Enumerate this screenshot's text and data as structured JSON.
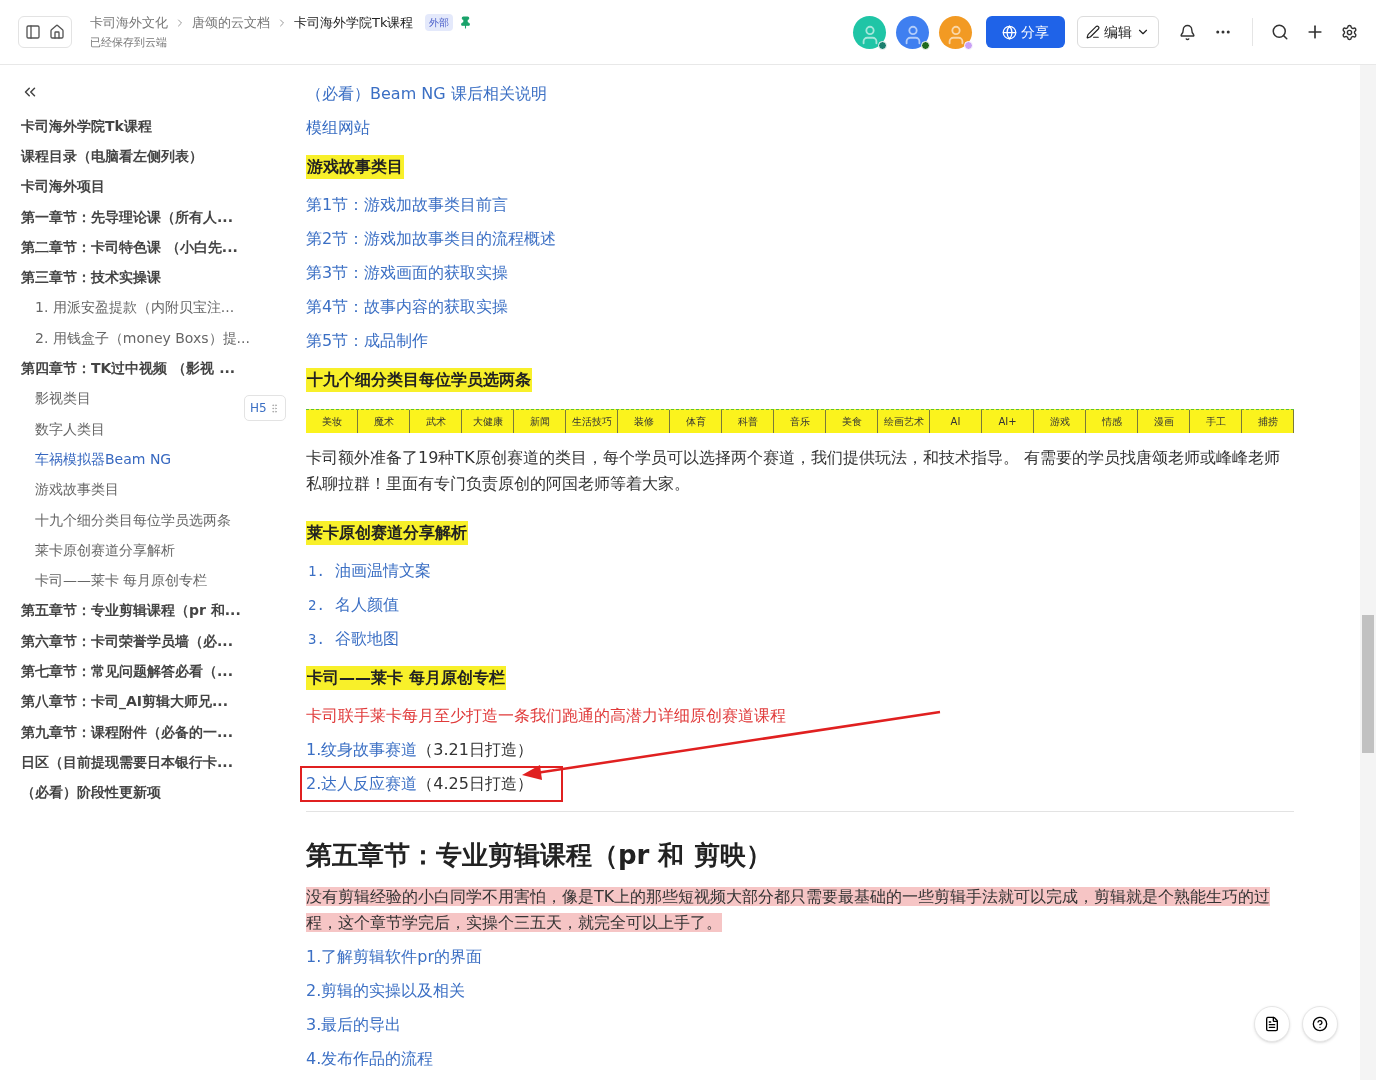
{
  "header": {
    "breadcrumbs": [
      {
        "label": "卡司海外文化",
        "current": false
      },
      {
        "label": "唐颂的云文档",
        "current": false
      },
      {
        "label": "卡司海外学院Tk课程",
        "current": true
      }
    ],
    "badge": "外部",
    "save_status": "已经保存到云端",
    "avatars": [
      {
        "color": "#1fc5a6",
        "status_dot": {
          "color": "#1a7f6e"
        }
      },
      {
        "color": "#3f7ff0",
        "status_dot": {
          "color": "#1f6b1f"
        }
      },
      {
        "color": "#f29a23",
        "status_dot": {
          "color": "#c9a0f5"
        }
      }
    ],
    "share_button": "分享",
    "edit_button": "编辑"
  },
  "sidebar": {
    "items": [
      {
        "label": "卡司海外学院Tk课程",
        "selected": false
      },
      {
        "label": "课程目录（电脑看左侧列表）",
        "selected": false
      },
      {
        "label": "卡司海外项目",
        "selected": false
      },
      {
        "label": "第一章节：先导理论课（所有人...",
        "selected": false
      },
      {
        "label": "第二章节：卡司特色课 （小白先...",
        "selected": false
      },
      {
        "label": "第三章节：技术实操课",
        "selected": false,
        "children": [
          {
            "label": "1. 用派安盈提款（内附贝宝注...",
            "selected": false
          },
          {
            "label": "2. 用钱盒子（money Boxs）提...",
            "selected": false
          }
        ]
      },
      {
        "label": "第四章节：TK过中视频 （影视 ...",
        "selected": false,
        "children": [
          {
            "label": "影视类目",
            "selected": false
          },
          {
            "label": "数字人类目",
            "selected": false
          },
          {
            "label": "车祸模拟器Beam NG",
            "selected": true
          },
          {
            "label": "游戏故事类目",
            "selected": false
          },
          {
            "label": "十九个细分类目每位学员选两条",
            "selected": false
          },
          {
            "label": "莱卡原创赛道分享解析",
            "selected": false
          },
          {
            "label": "卡司——莱卡 每月原创专栏",
            "selected": false
          }
        ]
      },
      {
        "label": "第五章节：专业剪辑课程（pr 和...",
        "selected": false
      },
      {
        "label": "第六章节：卡司荣誉学员墙（必...",
        "selected": false
      },
      {
        "label": "第七章节：常见问题解答必看（...",
        "selected": false
      },
      {
        "label": "第八章节：卡司_AI剪辑大师兄...",
        "selected": false
      },
      {
        "label": "第九章节：课程附件（必备的一...",
        "selected": false
      },
      {
        "label": "日区（目前提现需要日本银行卡...",
        "selected": false
      },
      {
        "label": "（必看）阶段性更新项",
        "selected": false
      }
    ],
    "heading_badge": "H5"
  },
  "content": [
    {
      "kind": "link",
      "text": "（必看）Beam NG 课后相关说明"
    },
    {
      "kind": "link",
      "text": "模组网站"
    },
    {
      "kind": "heading",
      "text": "游戏故事类目"
    },
    {
      "kind": "link",
      "text": "第1节：游戏加故事类目前言"
    },
    {
      "kind": "link",
      "text": "第2节：游戏加故事类目的流程概述"
    },
    {
      "kind": "link",
      "text": "第3节：游戏画面的获取实操"
    },
    {
      "kind": "link",
      "text": "第4节：故事内容的获取实操"
    },
    {
      "kind": "link",
      "text": "第5节：成品制作"
    },
    {
      "kind": "heading",
      "text": "十九个细分类目每位学员选两条"
    },
    {
      "kind": "categories",
      "cells": [
        "美妆",
        "魔术",
        "武术",
        "大健康",
        "新闻",
        "生活技巧",
        "装修",
        "体育",
        "科普",
        "音乐",
        "美食",
        "绘画艺术",
        "AI",
        "AI+",
        "游戏",
        "情感",
        "漫画",
        "手工",
        "捕捞"
      ]
    },
    {
      "kind": "paragraph",
      "text": "卡司额外准备了19种TK原创赛道的类目，每个学员可以选择两个赛道，我们提供玩法，和技术指导。 有需要的学员找唐颂老师或峰峰老师私聊拉群！里面有专门负责原创的阿国老师等着大家。"
    },
    {
      "kind": "heading",
      "text": "莱卡原创赛道分享解析"
    },
    {
      "kind": "numbered",
      "number": "1.",
      "text": "油画温情文案"
    },
    {
      "kind": "numbered",
      "number": "2.",
      "text": "名人颜值"
    },
    {
      "kind": "numbered",
      "number": "3.",
      "text": "谷歌地图"
    },
    {
      "kind": "heading",
      "text": "卡司——莱卡 每月原创专栏"
    },
    {
      "kind": "red_text",
      "text": "卡司联手莱卡每月至少打造一条我们跑通的高潜力详细原创赛道课程"
    },
    {
      "kind": "link_note",
      "link": "1.纹身故事赛道",
      "note": "（3.21日打造）",
      "boxed": false
    },
    {
      "kind": "link_note",
      "link": "2.达人反应赛道",
      "note": "（4.25日打造）",
      "boxed": true
    },
    {
      "kind": "divider"
    },
    {
      "kind": "title",
      "text": "第五章节：专业剪辑课程（pr 和 剪映）"
    },
    {
      "kind": "highlight_paragraph",
      "text": "没有剪辑经验的小白同学不用害怕，像是TK上的那些短视频大部分都只需要最基础的一些剪辑手法就可以完成，剪辑就是个熟能生巧的过程，这个章节学完后，实操个三五天，就完全可以上手了。"
    },
    {
      "kind": "link",
      "text": "1.了解剪辑软件pr的界面"
    },
    {
      "kind": "link",
      "text": "2.剪辑的实操以及相关"
    },
    {
      "kind": "link",
      "text": "3.最后的导出"
    },
    {
      "kind": "link",
      "text": "4.发布作品的流程"
    }
  ]
}
